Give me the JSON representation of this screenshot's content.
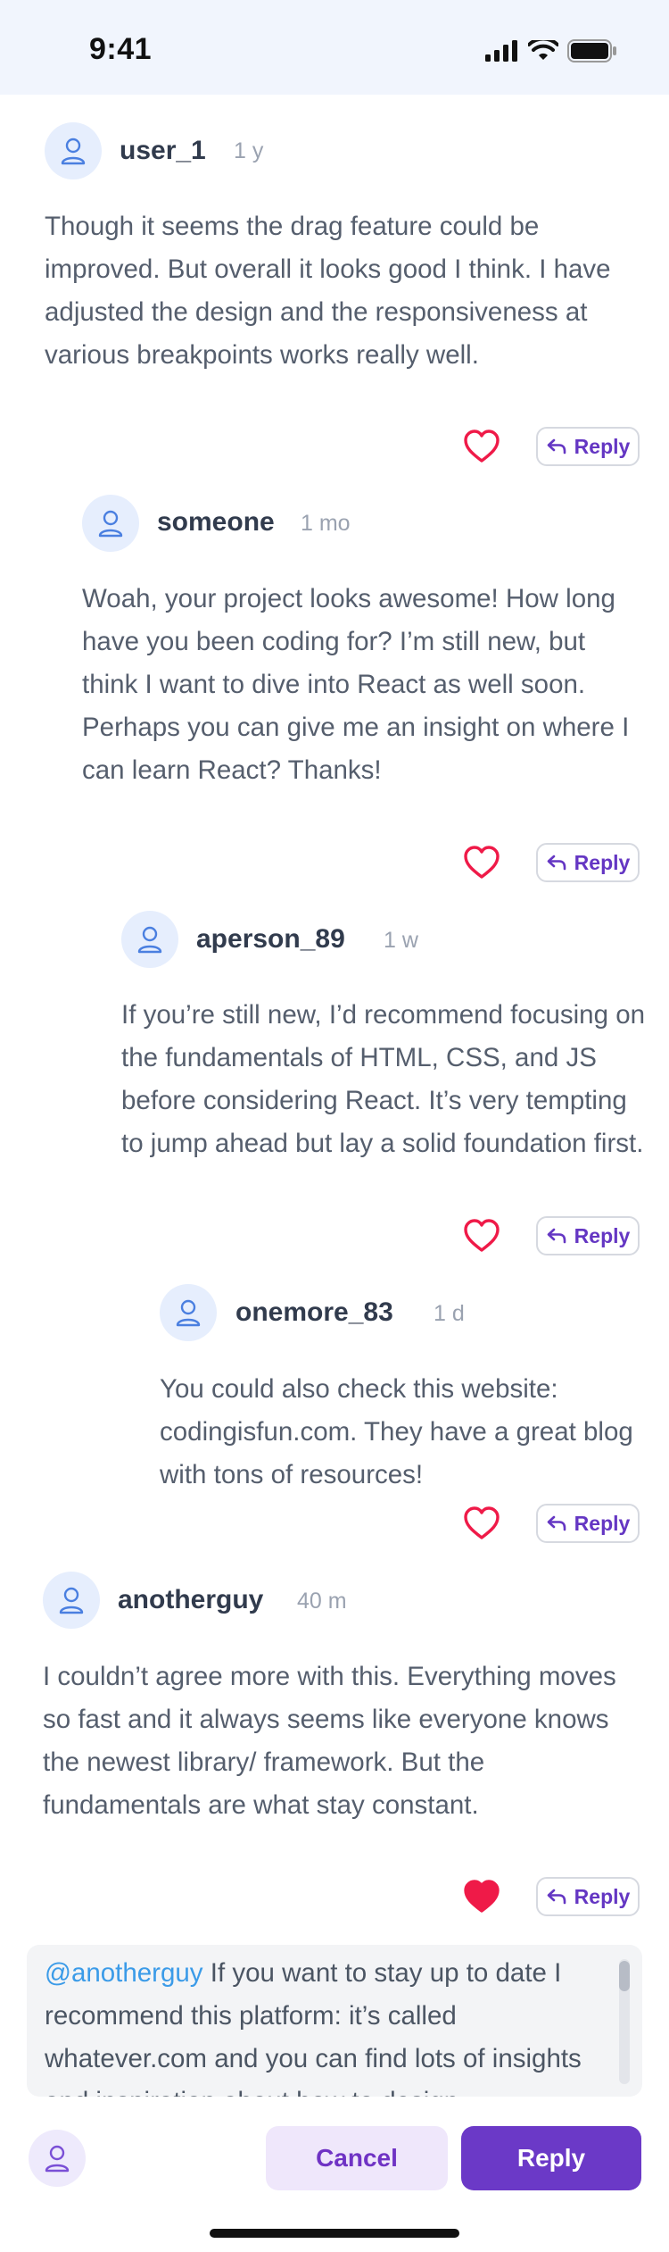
{
  "status_bar": {
    "time": "9:41"
  },
  "comments": [
    {
      "username": "user_1",
      "timestamp": "1 y",
      "text": "Though it seems the drag feature could be improved. But overall it looks good I think. I have adjusted the design and the responsiveness at various breakpoints works really well.",
      "liked": false,
      "reply_label": "Reply"
    },
    {
      "username": "someone",
      "timestamp": "1 mo",
      "text": "Woah, your project looks awesome! How long have you been coding for? I’m still new, but think I want to dive into React as well soon. Perhaps you can give me an insight on where I can learn React? Thanks!",
      "liked": false,
      "reply_label": "Reply"
    },
    {
      "username": "aperson_89",
      "timestamp": "1 w",
      "text": "If you’re still new, I’d recommend focusing on the fundamentals of HTML, CSS, and JS before considering React. It’s very tempting to jump ahead but lay a solid foundation first.",
      "liked": false,
      "reply_label": "Reply"
    },
    {
      "username": "onemore_83",
      "timestamp": "1 d",
      "text": "You could also check this website: codingisfun.com. They have a great blog with tons of resources!",
      "liked": false,
      "reply_label": "Reply"
    },
    {
      "username": "anotherguy",
      "timestamp": "40 m",
      "text": "I couldn’t agree more with this. Everything moves so fast and it always seems like everyone knows the newest library/ framework. But the fundamentals are what stay constant.",
      "liked": true,
      "reply_label": "Reply"
    }
  ],
  "reply_input": {
    "mention": "@anotherguy",
    "text": " If you want to stay up to date I recommend this platform: it’s called whatever.com and you can find lots of insights and inspiration about how to design"
  },
  "actions": {
    "cancel_label": "Cancel",
    "reply_label": "Reply"
  },
  "colors": {
    "accent": "#6b39c7",
    "heart": "#ef1a48",
    "mention": "#3b9be8",
    "status_bar_bg": "#f1f5fd"
  }
}
